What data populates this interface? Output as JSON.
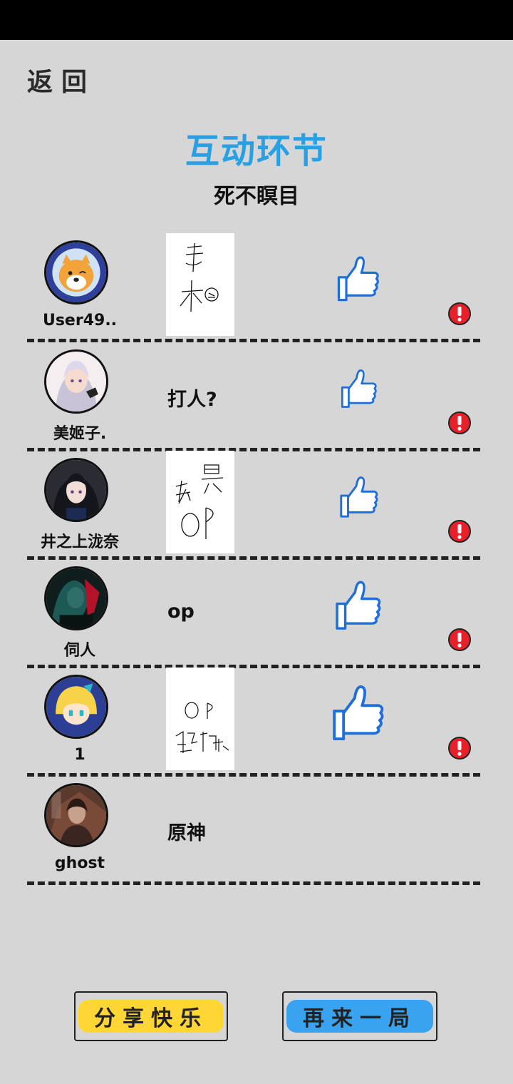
{
  "header": {
    "back_label": "返回",
    "title": "互动环节",
    "subtitle": "死不瞑目"
  },
  "rows": [
    {
      "username": "User49..",
      "answer": "",
      "answer_type": "drawing",
      "has_like": true,
      "has_report": true
    },
    {
      "username": "美姬子.",
      "answer": "打人?",
      "answer_type": "text",
      "has_like": true,
      "has_report": true
    },
    {
      "username": "井之上泷奈",
      "answer": "",
      "answer_type": "drawing",
      "has_like": true,
      "has_report": true
    },
    {
      "username": "伺人",
      "answer": "op",
      "answer_type": "text",
      "has_like": true,
      "has_report": true
    },
    {
      "username": "1",
      "answer": "",
      "answer_type": "drawing",
      "has_like": true,
      "has_report": true
    },
    {
      "username": "ghost",
      "answer": "原神",
      "answer_type": "text",
      "has_like": false,
      "has_report": false
    }
  ],
  "footer": {
    "share_label": "分享快乐",
    "replay_label": "再来一局"
  },
  "colors": {
    "title": "#2aa0e4",
    "like_icon": "#1e6fd9",
    "report_icon": "#e8202a",
    "share_fill": "#ffd633",
    "replay_fill": "#3aa3f0",
    "background": "#d6d6d6"
  },
  "icons": {
    "like": "thumbs-up-icon",
    "report": "exclamation-icon"
  }
}
